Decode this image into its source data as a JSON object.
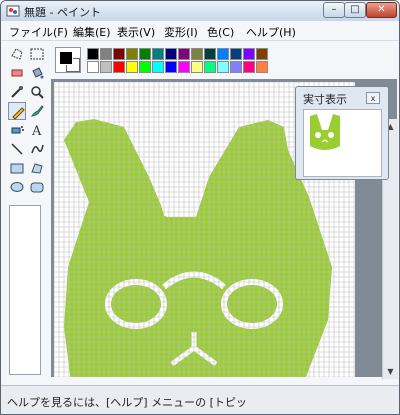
{
  "window": {
    "title": "無題 - ペイント"
  },
  "titlebar_buttons": {
    "minimize": "–",
    "maximize": "□",
    "close": "✕"
  },
  "menu": {
    "items": [
      {
        "label": "ファイル(F)"
      },
      {
        "label": "編集(E)"
      },
      {
        "label": "表示(V)"
      },
      {
        "label": "変形(I)"
      },
      {
        "label": "色(C)"
      },
      {
        "label": "ヘルプ(H)"
      }
    ]
  },
  "tools": [
    {
      "name": "free-select-icon"
    },
    {
      "name": "rect-select-icon"
    },
    {
      "name": "eraser-icon"
    },
    {
      "name": "fill-bucket-icon"
    },
    {
      "name": "color-picker-icon"
    },
    {
      "name": "magnifier-icon"
    },
    {
      "name": "pencil-icon",
      "selected": true
    },
    {
      "name": "brush-icon"
    },
    {
      "name": "airbrush-icon"
    },
    {
      "name": "text-icon"
    },
    {
      "name": "line-icon"
    },
    {
      "name": "curve-icon"
    },
    {
      "name": "rectangle-icon"
    },
    {
      "name": "polygon-icon"
    },
    {
      "name": "ellipse-icon"
    },
    {
      "name": "rounded-rect-icon"
    }
  ],
  "palette": {
    "top_row": [
      "#000000",
      "#808080",
      "#800000",
      "#808000",
      "#008000",
      "#008080",
      "#000080",
      "#800080",
      "#808040",
      "#004040",
      "#0080ff",
      "#004080",
      "#8000ff",
      "#804000"
    ],
    "bottom_row": [
      "#ffffff",
      "#c0c0c0",
      "#ff0000",
      "#ffff00",
      "#00ff00",
      "#00ffff",
      "#0000ff",
      "#ff00ff",
      "#ffff80",
      "#00ff80",
      "#80ffff",
      "#8080ff",
      "#ff0080",
      "#ff8040"
    ],
    "foreground": "#000000",
    "background": "#ffffff"
  },
  "colors": {
    "accent": "#9acd32",
    "grid": "#c0c0c0"
  },
  "preview": {
    "title": "実寸表示",
    "close": "x"
  },
  "status": {
    "text": "ヘルプを見るには、[ヘルプ] メニューの [トピッ"
  }
}
